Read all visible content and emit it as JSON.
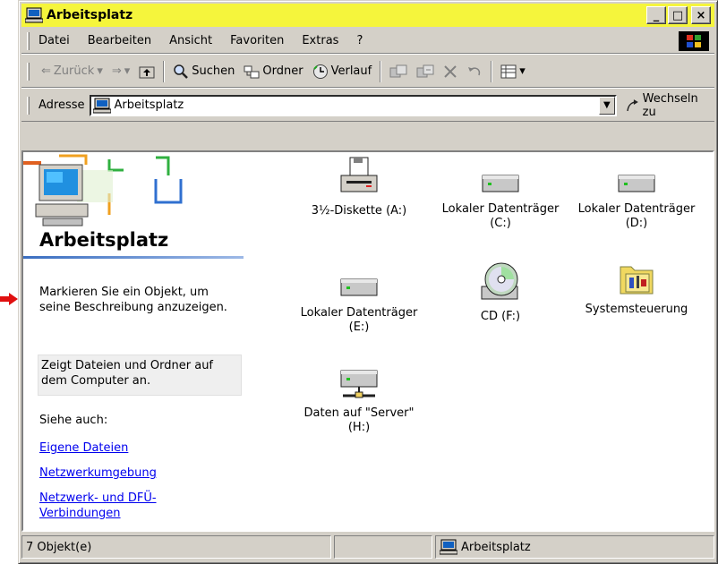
{
  "window": {
    "title": "Arbeitsplatz",
    "buttons": [
      "_",
      "□",
      "×"
    ]
  },
  "menu": {
    "items": [
      "Datei",
      "Bearbeiten",
      "Ansicht",
      "Favoriten",
      "Extras",
      "?"
    ]
  },
  "toolbar": {
    "back": "Zurück",
    "search": "Suchen",
    "folders": "Ordner",
    "history": "Verlauf"
  },
  "address": {
    "label": "Adresse",
    "value": "Arbeitsplatz",
    "go": "Wechseln zu"
  },
  "left_panel": {
    "title": "Arbeitsplatz",
    "description": "Markieren Sie ein Objekt, um seine Beschreibung anzuzeigen.",
    "info": "Zeigt Dateien und Ordner auf dem Computer an.",
    "see_also": "Siehe auch:",
    "links": [
      "Eigene Dateien",
      "Netzwerkumgebung",
      "Netzwerk- und DFÜ-Verbindungen"
    ]
  },
  "items": [
    {
      "label": "3½-Diskette (A:)",
      "icon": "floppy-drive-icon"
    },
    {
      "label": "Lokaler Datenträger (C:)",
      "icon": "hard-drive-icon"
    },
    {
      "label": "Lokaler Datenträger (D:)",
      "icon": "hard-drive-icon"
    },
    {
      "label": "Lokaler Datenträger (E:)",
      "icon": "hard-drive-icon"
    },
    {
      "label": "CD (F:)",
      "icon": "cd-drive-icon"
    },
    {
      "label": "Systemsteuerung",
      "icon": "control-panel-icon"
    },
    {
      "label": "Daten auf \"Server\" (H:)",
      "icon": "network-drive-icon"
    }
  ],
  "status": {
    "count": "7 Objekt(e)",
    "location": "Arbeitsplatz"
  },
  "colors": {
    "titlebar": "#f5f53c",
    "face": "#d4d0c8",
    "link": "#0000ee"
  }
}
